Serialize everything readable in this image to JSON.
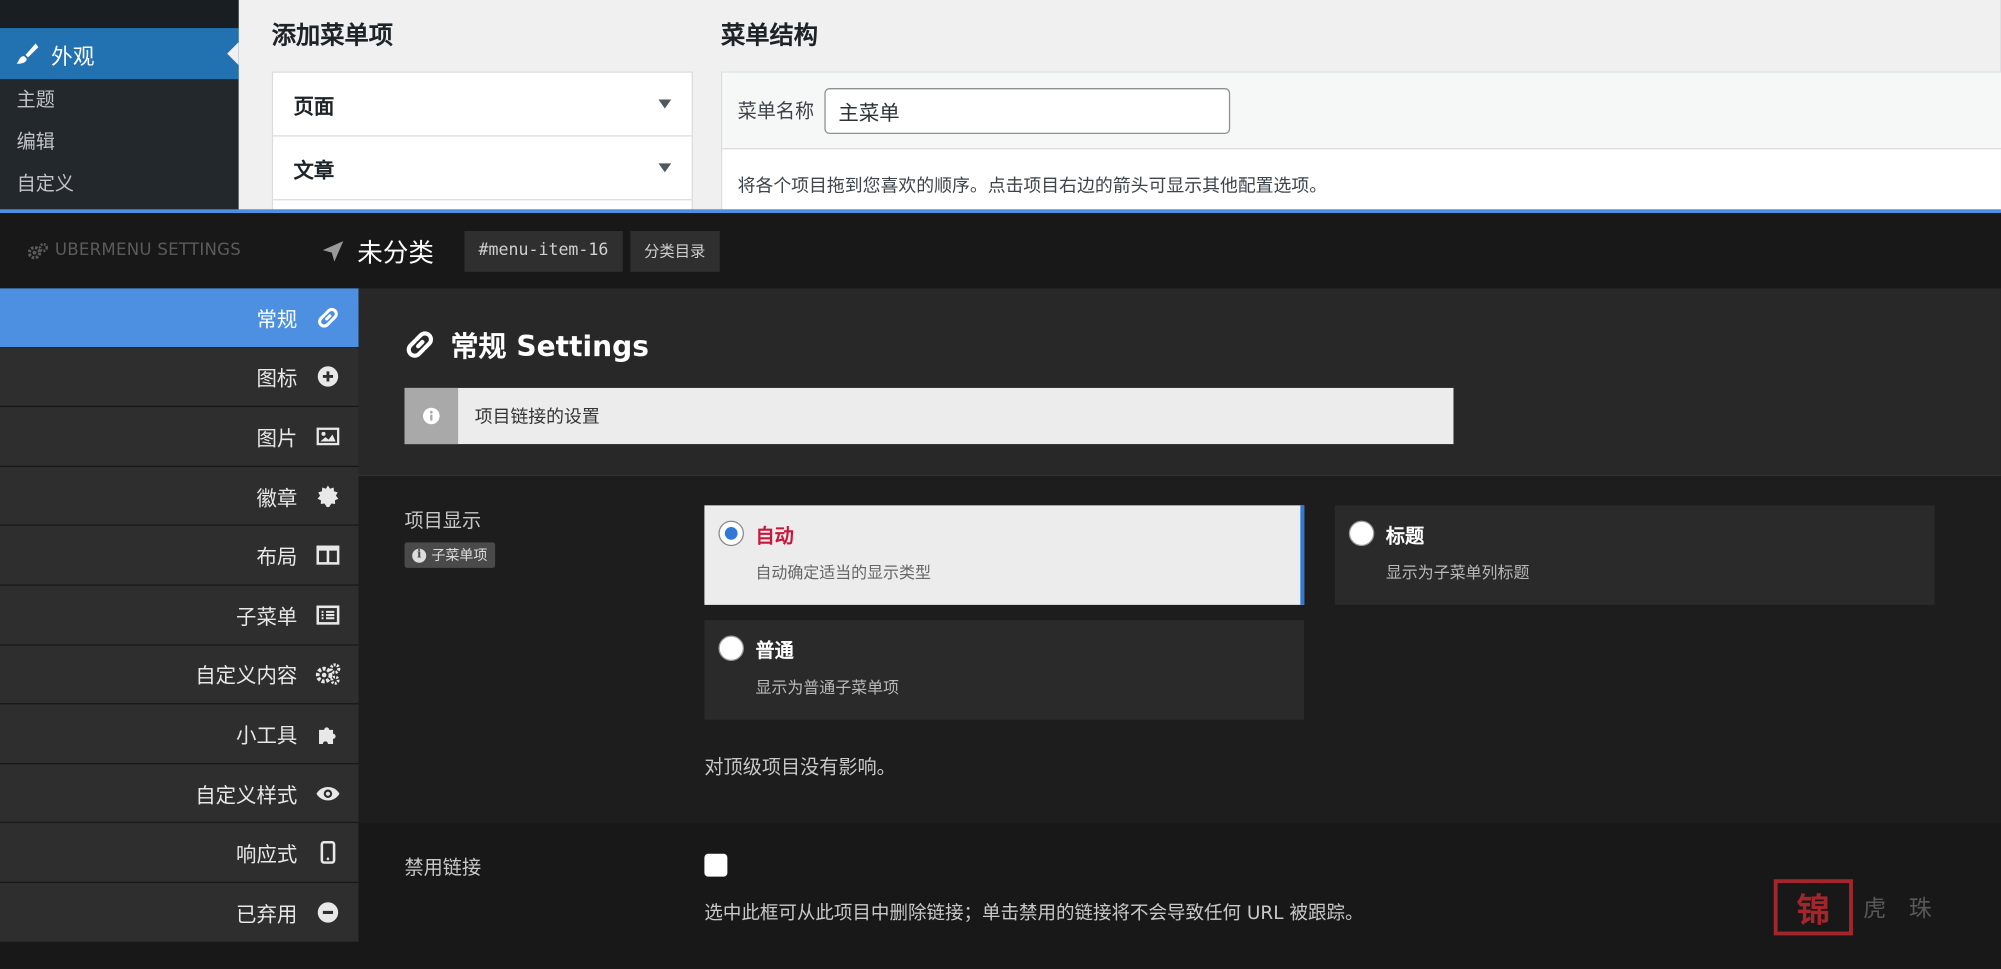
{
  "wp": {
    "active_menu": "外观",
    "submenu": [
      "主题",
      "编辑",
      "自定义"
    ],
    "add_items_title": "添加菜单项",
    "accordion": [
      "页面",
      "文章"
    ],
    "structure_title": "菜单结构",
    "menu_name_label": "菜单名称",
    "menu_name_value": "主菜单",
    "structure_desc": "将各个项目拖到您喜欢的顺序。点击项目右边的箭头可显示其他配置选项。"
  },
  "header": {
    "brand": "UBERMENU SETTINGS",
    "item_title": "未分类",
    "item_id": "#menu-item-16",
    "item_type": "分类目录"
  },
  "nav": [
    {
      "label": "常规",
      "icon": "link-icon",
      "active": true
    },
    {
      "label": "图标",
      "icon": "plus-circle-icon"
    },
    {
      "label": "图片",
      "icon": "image-icon"
    },
    {
      "label": "徽章",
      "icon": "badge-icon"
    },
    {
      "label": "布局",
      "icon": "columns-icon"
    },
    {
      "label": "子菜单",
      "icon": "list-icon"
    },
    {
      "label": "自定义内容",
      "icon": "cogs-icon"
    },
    {
      "label": "小工具",
      "icon": "puzzle-icon"
    },
    {
      "label": "自定义样式",
      "icon": "eye-icon"
    },
    {
      "label": "响应式",
      "icon": "mobile-icon"
    },
    {
      "label": "已弃用",
      "icon": "minus-circle-icon"
    }
  ],
  "main": {
    "title": "常规 Settings",
    "info": "项目链接的设置",
    "display_label": "项目显示",
    "display_badge": "子菜单项",
    "options": [
      {
        "title": "自动",
        "desc": "自动确定适当的显示类型",
        "selected": true
      },
      {
        "title": "标题",
        "desc": "显示为子菜单列标题",
        "selected": false
      },
      {
        "title": "普通",
        "desc": "显示为普通子菜单项",
        "selected": false
      }
    ],
    "display_note": "对顶级项目没有影响。",
    "disable_label": "禁用链接",
    "disable_checked": false,
    "disable_desc": "选中此框可从此项目中删除链接；单击禁用的链接将不会导致任何 URL 被跟踪。"
  },
  "watermark": {
    "seal": "锦",
    "text": "虎 珠"
  },
  "colors": {
    "accent": "#4d8fe0",
    "wp_blue": "#2271b1",
    "selected_title": "#c8173a"
  }
}
